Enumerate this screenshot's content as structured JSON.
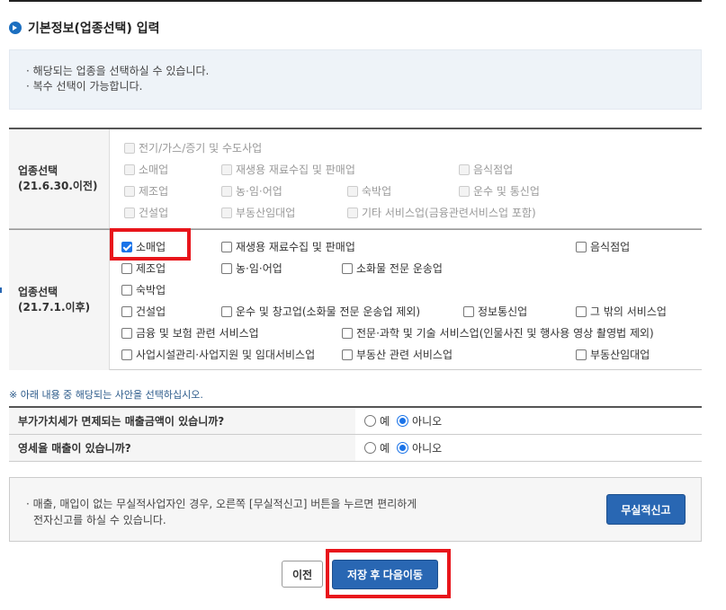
{
  "section": {
    "title": "기본정보(업종선택) 입력"
  },
  "info": [
    "· 해당되는 업종을 선택하실 수 있습니다.",
    "· 복수 선택이 가능합니다."
  ],
  "before": {
    "head1": "업종선택",
    "head2": "(21.6.30.이전)",
    "options": {
      "elec": "전기/가스/증기 및 수도사업",
      "retail": "소매업",
      "recycle": "재생용 재료수집 및 판매업",
      "food": "음식점업",
      "mfg": "제조업",
      "farm": "농·임·어업",
      "lodging": "숙박업",
      "transport": "운수 및 통신업",
      "construct": "건설업",
      "realestate_rent": "부동산임대업",
      "etc_service": "기타 서비스업(금융관련서비스업 포함)"
    }
  },
  "after": {
    "head1": "업종선택",
    "head2": "(21.7.1.이후)",
    "options": {
      "retail": "소매업",
      "recycle": "재생용 재료수집 및 판매업",
      "food": "음식점업",
      "mfg": "제조업",
      "farm": "농·임·어업",
      "cargo": "소화물 전문 운송업",
      "lodging": "숙박업",
      "construct": "건설업",
      "warehouse": "운수 및 창고업(소화물 전문 운송업 제외)",
      "info_comm": "정보통신업",
      "other_service": "그 밖의 서비스업",
      "finance": "금융 및 보험 관련 서비스업",
      "science": "전문·과학 및 기술 서비스업(인물사진 및 행사용 영상 촬영법 제외)",
      "facility": "사업시설관리·사업지원 및 임대서비스업",
      "realestate_service": "부동산 관련 서비스업",
      "realestate_rent": "부동산임대업"
    }
  },
  "notice": "※ 아래 내용 중 해당되는 사안을 선택하십시오.",
  "questions": [
    {
      "label": "부가가치세가 면제되는 매출금액이 있습니까?",
      "yes": "예",
      "no": "아니오"
    },
    {
      "label": "영세율 매출이 있습니까?",
      "yes": "예",
      "no": "아니오"
    }
  ],
  "nofile": {
    "text1": "· 매출, 매입이 없는 무실적사업자인 경우, 오른쪽 [무실적신고] 버튼을 누르면 편리하게",
    "text2": "전자신고를 하실 수 있습니다.",
    "button": "무실적신고"
  },
  "buttons": {
    "prev": "이전",
    "save": "저장 후 다음이동"
  }
}
